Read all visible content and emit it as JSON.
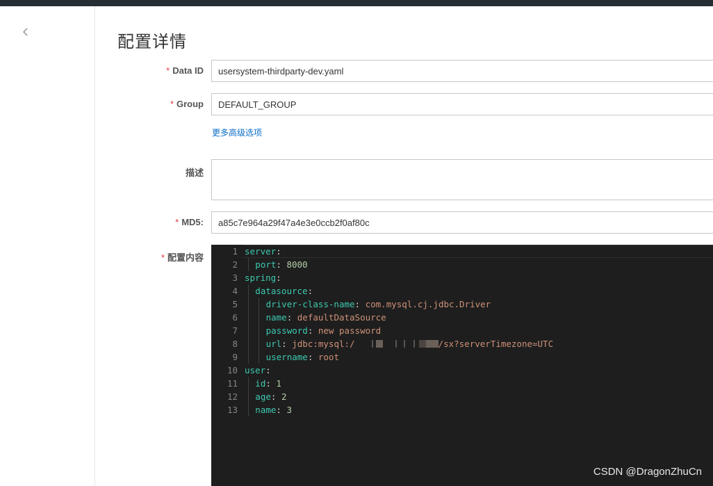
{
  "back_icon": "chevron-left-icon",
  "page_title": "配置详情",
  "form": {
    "data_id": {
      "label": "Data ID",
      "value": "usersystem-thirdparty-dev.yaml"
    },
    "group": {
      "label": "Group",
      "value": "DEFAULT_GROUP"
    },
    "advanced_link": "更多高级选项",
    "description": {
      "label": "描述",
      "value": ""
    },
    "md5": {
      "label": "MD5:",
      "value": "a85c7e964a29f47a4e3e0ccb2f0af80c"
    },
    "content": {
      "label": "配置内容"
    }
  },
  "editor": {
    "line_numbers": [
      "1",
      "2",
      "3",
      "4",
      "5",
      "6",
      "7",
      "8",
      "9",
      "10",
      "11",
      "12",
      "13"
    ],
    "lines": [
      {
        "key": "server",
        "sep": ":",
        "value": "",
        "vtype": ""
      },
      {
        "key": "port",
        "sep": ": ",
        "value": "8000",
        "vtype": "n"
      },
      {
        "key": "spring",
        "sep": ":",
        "value": "",
        "vtype": ""
      },
      {
        "key": "datasource",
        "sep": ":",
        "value": "",
        "vtype": ""
      },
      {
        "key": "driver-class-name",
        "sep": ": ",
        "value": "com.mysql.cj.jdbc.Driver",
        "vtype": "s"
      },
      {
        "key": "name",
        "sep": ": ",
        "value": "defaultDataSource",
        "vtype": "s"
      },
      {
        "key": "password",
        "sep": ": ",
        "value": "new password",
        "vtype": "s"
      },
      {
        "key": "url",
        "sep": ": ",
        "value_prefix": "jdbc:mysql:/",
        "value_suffix": "/sx?serverTimezone=UTC",
        "vtype": "s"
      },
      {
        "key": "username",
        "sep": ": ",
        "value": "root",
        "vtype": "s"
      },
      {
        "key": "user",
        "sep": ":",
        "value": "",
        "vtype": ""
      },
      {
        "key": "id",
        "sep": ": ",
        "value": "1",
        "vtype": "n"
      },
      {
        "key": "age",
        "sep": ": ",
        "value": "2",
        "vtype": "n"
      },
      {
        "key": "name",
        "sep": ": ",
        "value": "3",
        "vtype": "n"
      }
    ],
    "colors": {
      "background": "#1e1e1e",
      "key": "#3dc9b0",
      "string": "#ce9178",
      "number": "#b5cea8",
      "line_number": "#858585"
    }
  },
  "watermark": "CSDN @DragonZhuCn",
  "colors": {
    "required_star": "#e5393d",
    "link": "#0a6ec8",
    "topbar": "#262d33"
  }
}
